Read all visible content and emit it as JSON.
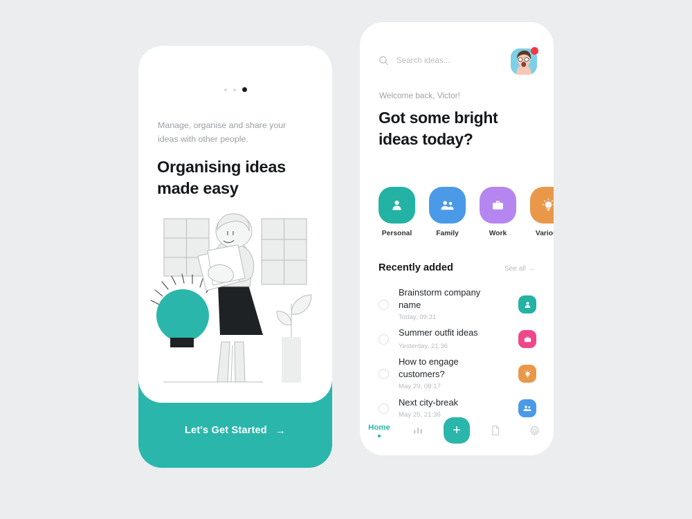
{
  "theme": {
    "background": "#ebedef",
    "teal": "#2bb6ab",
    "blue": "#4a90e2",
    "purple": "#b07ff0",
    "orange": "#eb9b4e",
    "pink": "#f0468a",
    "red": "#fb3640",
    "dark": "#15181b"
  },
  "onboarding": {
    "dots": [
      {
        "name": "page-dot-1",
        "active": false
      },
      {
        "name": "page-dot-2",
        "active": false
      },
      {
        "name": "page-dot-3",
        "active": true
      }
    ],
    "lede": "Manage, organise and share your ideas with other people.",
    "headline": "Organising ideas made easy",
    "cta_label": "Let's Get Started",
    "cta_arrow": "→",
    "illustration_name": "woman-with-lightbulb-illustration"
  },
  "home": {
    "search": {
      "placeholder": "Search ideas...",
      "icon": "search-icon"
    },
    "avatar": {
      "name": "user-avatar",
      "notification": true
    },
    "welcome": "Welcome back, Victor!",
    "title": "Got some bright ideas today?",
    "categories": [
      {
        "label": "Personal",
        "color": "#23b2a3",
        "icon": "person-icon"
      },
      {
        "label": "Family",
        "color": "#4a9ae8",
        "icon": "people-icon"
      },
      {
        "label": "Work",
        "color": "#b585f0",
        "icon": "briefcase-icon"
      },
      {
        "label": "Various",
        "color": "#e9984a",
        "icon": "lightbulb-icon"
      }
    ],
    "section": {
      "title": "Recently added",
      "link": "See all",
      "link_arrow": "→"
    },
    "items": [
      {
        "title": "Brainstorm company name",
        "time": "Today, 09:31",
        "color": "#23b2a3",
        "icon": "person-icon"
      },
      {
        "title": "Summer outfit ideas",
        "time": "Yesterday, 21:36",
        "color": "#f0468a",
        "icon": "briefcase-icon"
      },
      {
        "title": "How to engage customers?",
        "time": "May 29, 08:17",
        "color": "#e9984a",
        "icon": "lightbulb-icon"
      },
      {
        "title": "Next city-break",
        "time": "May 25, 21:36",
        "color": "#4a9ae8",
        "icon": "people-icon"
      }
    ],
    "nav": [
      {
        "label": "Home",
        "icon": "home-label",
        "active": true
      },
      {
        "label": "",
        "icon": "bar-chart-icon",
        "active": false
      },
      {
        "label": "+",
        "icon": "plus-icon",
        "active": false
      },
      {
        "label": "",
        "icon": "document-icon",
        "active": false
      },
      {
        "label": "",
        "icon": "gear-icon",
        "active": false
      }
    ]
  }
}
